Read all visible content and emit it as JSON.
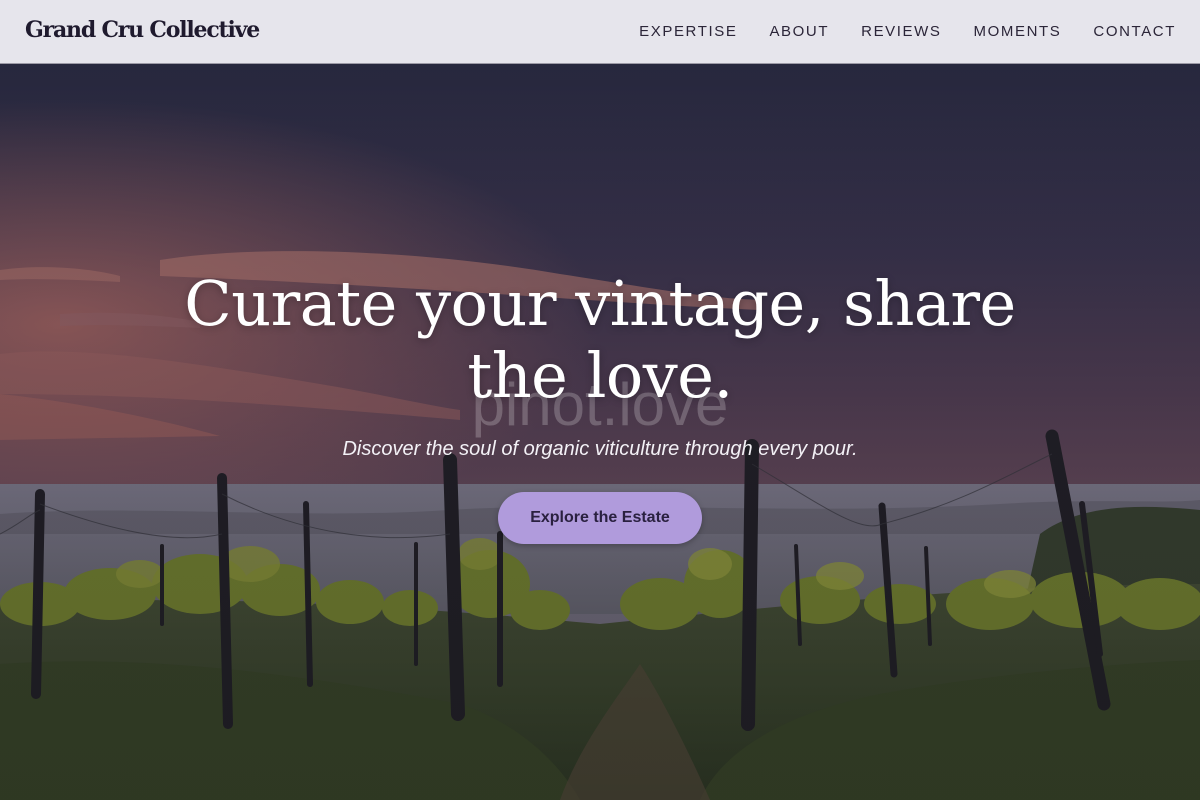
{
  "brand": {
    "name": "Grand Cru Collective"
  },
  "nav": {
    "links": [
      {
        "label": "EXPERTISE"
      },
      {
        "label": "ABOUT"
      },
      {
        "label": "REVIEWS"
      },
      {
        "label": "MOMENTS"
      },
      {
        "label": "CONTACT"
      }
    ]
  },
  "hero": {
    "title": "Curate your vintage, share the love.",
    "watermark": "pinot.love",
    "subtitle": "Discover the soul of organic viticulture through every pour.",
    "cta_label": "Explore the Estate",
    "image_description_icon": "vineyard-landscape-image"
  },
  "colors": {
    "nav_background": "#e6e5ec",
    "brand_text": "#1f1a2e",
    "cta_background": "#b09bdc",
    "cta_text": "#2a2140",
    "hero_text": "#ffffff"
  }
}
